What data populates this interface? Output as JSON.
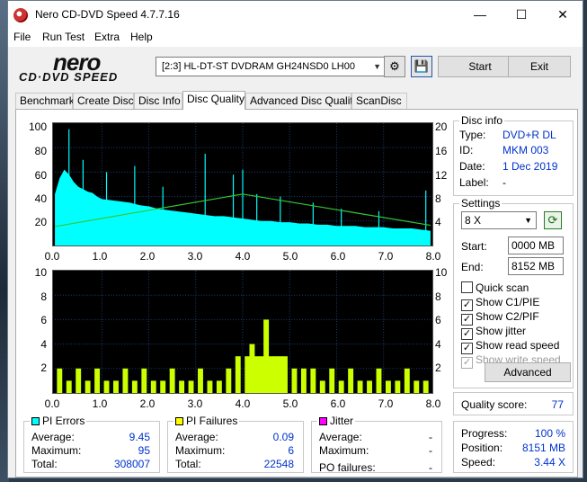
{
  "window": {
    "title": "Nero CD-DVD Speed 4.7.7.16",
    "min": "—",
    "max": "☐",
    "close": "✕"
  },
  "menu": [
    "File",
    "Run Test",
    "Extra",
    "Help"
  ],
  "logo": {
    "line1": "nero",
    "line2": "CD·DVD SPEED"
  },
  "drive": {
    "selected": "[2:3]   HL-DT-ST DVDRAM GH24NSD0 LH00"
  },
  "toolbar": {
    "start": "Start",
    "exit": "Exit"
  },
  "tabs": [
    "Benchmark",
    "Create Disc",
    "Disc Info",
    "Disc Quality",
    "Advanced Disc Quality",
    "ScanDisc"
  ],
  "active_tab": "Disc Quality",
  "chart_data": [
    {
      "type": "area",
      "title": "PI Errors / Read speed",
      "x_ticks": [
        "0.0",
        "1.0",
        "2.0",
        "3.0",
        "4.0",
        "5.0",
        "6.0",
        "7.0",
        "8.0"
      ],
      "y_left_ticks": [
        "100",
        "80",
        "60",
        "40",
        "20"
      ],
      "y_right_ticks": [
        "20",
        "16",
        "12",
        "8",
        "4"
      ],
      "xlim": [
        0,
        8.0
      ],
      "ylim_left": [
        0,
        100
      ],
      "ylim_right": [
        0,
        20
      ],
      "series": [
        {
          "name": "PI Errors",
          "color": "#00ffff",
          "x": [
            0.0,
            0.1,
            0.2,
            0.3,
            0.4,
            0.5,
            0.6,
            0.7,
            0.8,
            0.9,
            1.0,
            1.2,
            1.4,
            1.6,
            1.8,
            2.0,
            2.2,
            2.4,
            2.6,
            2.8,
            3.0,
            3.2,
            3.4,
            3.6,
            3.8,
            4.0,
            4.2,
            4.4,
            4.6,
            4.8,
            5.0,
            5.2,
            5.4,
            5.6,
            5.8,
            6.0,
            6.2,
            6.4,
            6.6,
            6.8,
            7.0,
            7.2,
            7.4,
            7.6,
            7.8,
            8.0
          ],
          "y": [
            42,
            55,
            62,
            58,
            52,
            48,
            46,
            44,
            43,
            40,
            38,
            37,
            36,
            35,
            33,
            32,
            30,
            29,
            28,
            27,
            26,
            25,
            24,
            24,
            23,
            22,
            21,
            20,
            20,
            19,
            19,
            18,
            18,
            17,
            17,
            16,
            16,
            16,
            15,
            15,
            15,
            14,
            14,
            14,
            13,
            12
          ]
        },
        {
          "name": "Read speed",
          "color": "#33cc33",
          "x": [
            0.0,
            4.0,
            8.0
          ],
          "y": [
            3.1,
            8.4,
            3.3
          ]
        }
      ],
      "spikes": {
        "x": [
          0.3,
          0.6,
          1.1,
          1.7,
          2.3,
          3.2,
          3.8,
          4.0,
          4.3,
          4.8,
          5.5,
          6.1,
          6.9,
          7.9
        ],
        "y": [
          95,
          70,
          60,
          65,
          48,
          75,
          58,
          62,
          42,
          40,
          35,
          30,
          28,
          45
        ]
      }
    },
    {
      "type": "bar",
      "title": "PI Failures",
      "x_ticks": [
        "0.0",
        "1.0",
        "2.0",
        "3.0",
        "4.0",
        "5.0",
        "6.0",
        "7.0",
        "8.0"
      ],
      "y_left_ticks": [
        "10",
        "8",
        "6",
        "4",
        "2"
      ],
      "y_right_ticks": [
        "10",
        "8",
        "6",
        "4",
        "2"
      ],
      "xlim": [
        0,
        8.0
      ],
      "ylim": [
        0,
        10
      ],
      "series": [
        {
          "name": "PI Failures",
          "color": "#ccff00",
          "x": [
            0.1,
            0.3,
            0.5,
            0.7,
            0.9,
            1.1,
            1.3,
            1.5,
            1.7,
            1.9,
            2.1,
            2.3,
            2.5,
            2.7,
            2.9,
            3.1,
            3.3,
            3.5,
            3.7,
            3.9,
            4.1,
            4.2,
            4.3,
            4.4,
            4.5,
            4.6,
            4.7,
            4.8,
            4.9,
            5.1,
            5.3,
            5.5,
            5.7,
            5.9,
            6.1,
            6.3,
            6.5,
            6.7,
            6.9,
            7.1,
            7.3,
            7.5,
            7.7,
            7.9
          ],
          "y": [
            2,
            1,
            2,
            1,
            2,
            1,
            1,
            2,
            1,
            2,
            1,
            1,
            2,
            1,
            1,
            2,
            1,
            1,
            2,
            3,
            3,
            4,
            3,
            3,
            6,
            3,
            3,
            3,
            3,
            2,
            2,
            2,
            1,
            2,
            1,
            2,
            1,
            1,
            2,
            1,
            1,
            2,
            1,
            1
          ]
        }
      ]
    }
  ],
  "disc_info": {
    "title": "Disc info",
    "type_label": "Type:",
    "type": "DVD+R DL",
    "id_label": "ID:",
    "id": "MKM 003",
    "date_label": "Date:",
    "date": "1 Dec 2019",
    "label_label": "Label:",
    "label": "-"
  },
  "settings": {
    "title": "Settings",
    "speed": "8 X",
    "start_label": "Start:",
    "start": "0000 MB",
    "end_label": "End:",
    "end": "8152 MB",
    "checks": [
      {
        "label": "Quick scan",
        "checked": false,
        "disabled": false
      },
      {
        "label": "Show C1/PIE",
        "checked": true,
        "disabled": false
      },
      {
        "label": "Show C2/PIF",
        "checked": true,
        "disabled": false
      },
      {
        "label": "Show jitter",
        "checked": true,
        "disabled": false
      },
      {
        "label": "Show read speed",
        "checked": true,
        "disabled": false
      },
      {
        "label": "Show write speed",
        "checked": true,
        "disabled": true
      }
    ],
    "advanced": "Advanced"
  },
  "quality": {
    "label": "Quality score:",
    "value": "77"
  },
  "progress": {
    "progress_label": "Progress:",
    "progress": "100 %",
    "position_label": "Position:",
    "position": "8151 MB",
    "speed_label": "Speed:",
    "speed": "3.44 X"
  },
  "pi_errors": {
    "title": "PI Errors",
    "color": "#00ffff",
    "avg_label": "Average:",
    "avg": "9.45",
    "max_label": "Maximum:",
    "max": "95",
    "total_label": "Total:",
    "total": "308007"
  },
  "pi_failures": {
    "title": "PI Failures",
    "color": "#ffff00",
    "avg_label": "Average:",
    "avg": "0.09",
    "max_label": "Maximum:",
    "max": "6",
    "total_label": "Total:",
    "total": "22548"
  },
  "jitter": {
    "title": "Jitter",
    "color": "#ff00ff",
    "avg_label": "Average:",
    "avg": "-",
    "max_label": "Maximum:",
    "max": "-",
    "po_label": "PO failures:",
    "po": "-"
  }
}
